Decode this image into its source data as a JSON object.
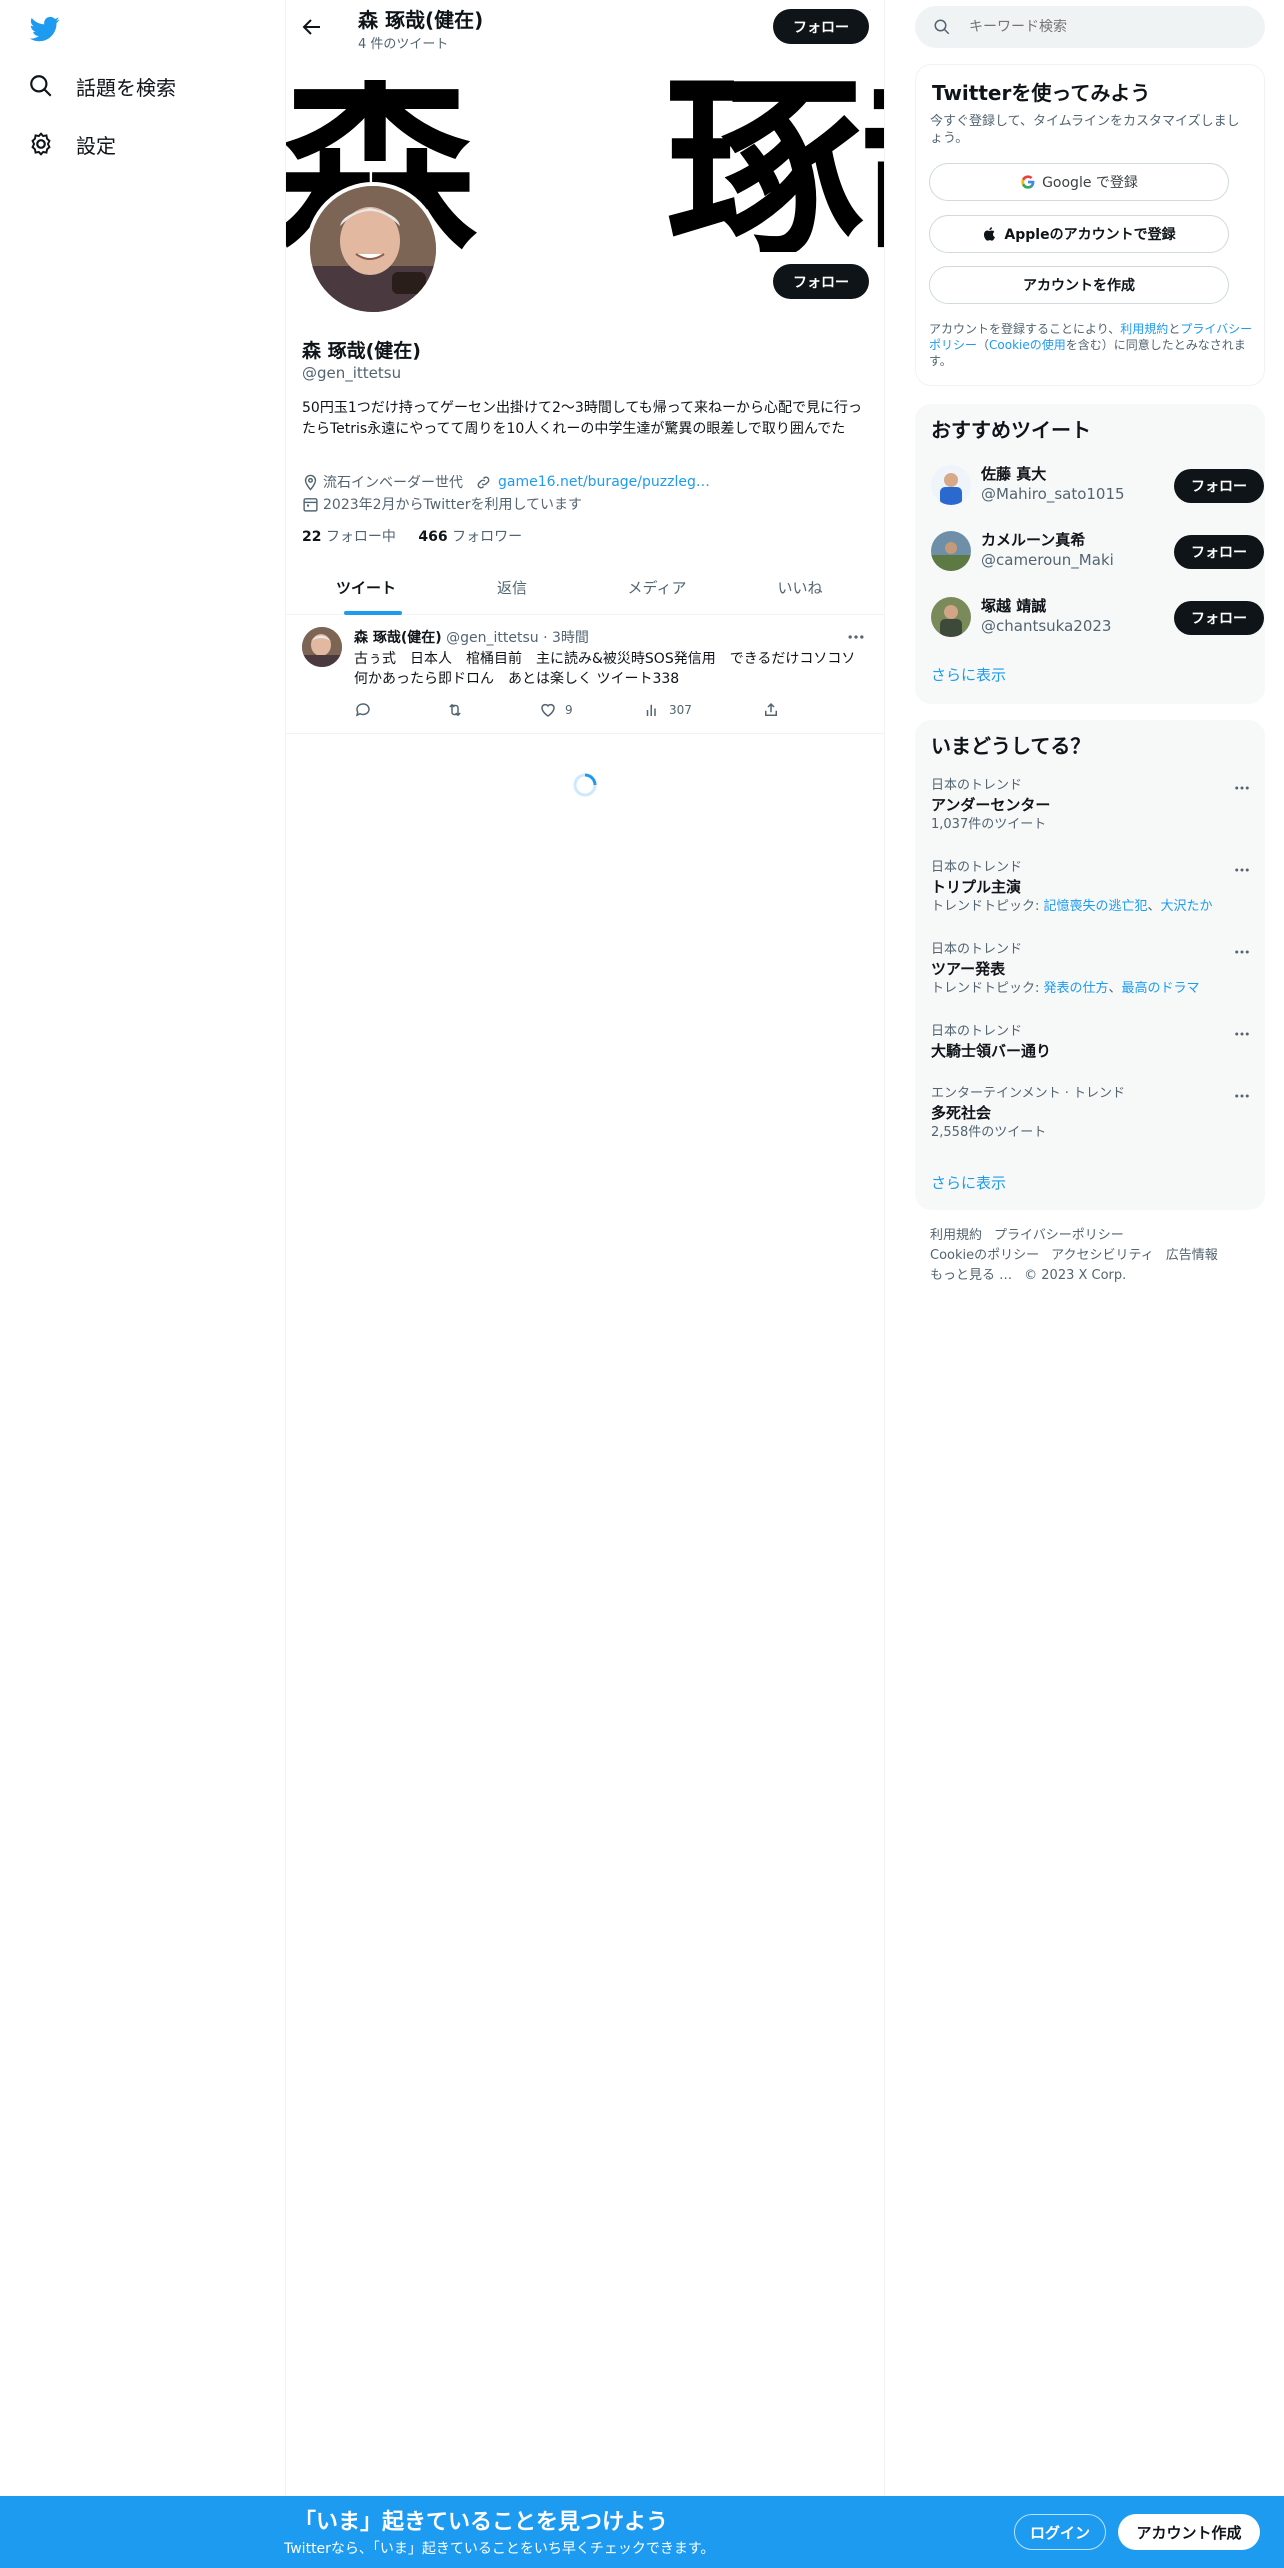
{
  "colors": {
    "accent": "#1d9bf0",
    "text": "#0f1419",
    "muted": "#536471"
  },
  "nav": {
    "logo": "twitter-bird-icon",
    "explore_label": "話題を検索",
    "settings_label": "設定"
  },
  "header": {
    "name": "森 琢哉(健在)",
    "tweet_count": "4 件のツイート",
    "follow_label": "フォロー"
  },
  "banner": {
    "text": "森　琢哉"
  },
  "profile": {
    "name": "森 琢哉(健在)",
    "handle": "@gen_ittetsu",
    "bio": "50円玉1つだけ持ってゲーセン出掛けて2〜3時間しても帰って来ねーから心配で見に行ったらTetris永遠にやってて周りを10人くれーの中学生達が驚異の眼差しで取り囲んでた",
    "location": "流石インベーダー世代",
    "url": "game16.net/burage/puzzleg…",
    "joined": "2023年2月からTwitterを利用しています",
    "following_count": "22",
    "following_label": "フォロー中",
    "followers_count": "466",
    "followers_label": "フォロワー",
    "follow_label": "フォロー"
  },
  "tabs": [
    "ツイート",
    "返信",
    "メディア",
    "いいね"
  ],
  "tweet": {
    "name": "森 琢哉(健在)",
    "handle": "@gen_ittetsu",
    "time": "· 3時間",
    "text": "古ぅ式　日本人　棺桶目前　主に読み&被災時SOS発信用　できるだけコソコソ　何かあったら即ドロん　あとは楽しく ツイート338",
    "likes": "9",
    "views": "307"
  },
  "search": {
    "placeholder": "キーワード検索"
  },
  "signup": {
    "title": "Twitterを使ってみよう",
    "subtitle": "今すぐ登録して、タイムラインをカスタマイズしましょう。",
    "google_label": "Google で登録",
    "apple_label": "Appleのアカウントで登録",
    "create_label": "アカウントを作成",
    "legal_1": "アカウントを登録することにより、",
    "legal_terms": "利用規約",
    "legal_2": "と",
    "legal_privacy": "プライバシーポリシー",
    "legal_3": "（",
    "legal_cookie": "Cookieの使用",
    "legal_4": "を含む）に同意したとみなされます。"
  },
  "who_to_follow": {
    "title": "おすすめツイート",
    "users": [
      {
        "name": "佐藤 真大",
        "handle": "@Mahiro_sato1015",
        "follow": "フォロー"
      },
      {
        "name": "カメルーン真希",
        "handle": "@cameroun_Maki",
        "follow": "フォロー"
      },
      {
        "name": "塚越 靖誠",
        "handle": "@chantsuka2023",
        "follow": "フォロー"
      }
    ],
    "show_more": "さらに表示"
  },
  "trends": {
    "title": "いまどうしてる？",
    "items": [
      {
        "context": "日本のトレンド",
        "name": "アンダーセンター",
        "sub": "1,037件のツイート"
      },
      {
        "context": "日本のトレンド",
        "name": "トリプル主演",
        "sub_prefix": "トレンドトピック: ",
        "link1": "記憶喪失の逃亡犯",
        "sep": "、",
        "link2": "大沢たか"
      },
      {
        "context": "日本のトレンド",
        "name": "ツアー発表",
        "sub_prefix": "トレンドトピック: ",
        "link1": "発表の仕方",
        "sep": "、",
        "link2": "最高のドラマ"
      },
      {
        "context": "日本のトレンド",
        "name": "大騎士領バー通り"
      },
      {
        "context": "エンターテインメント · トレンド",
        "name": "多死社会",
        "sub": "2,558件のツイート"
      }
    ],
    "show_more": "さらに表示"
  },
  "footer": {
    "terms": "利用規約",
    "privacy": "プライバシーポリシー",
    "cookie": "Cookieのポリシー",
    "accessibility": "アクセシビリティ",
    "ads": "広告情報",
    "more": "もっと見る …",
    "copyright": "© 2023 X Corp."
  },
  "bottom_bar": {
    "title": "「いま」起きていることを見つけよう",
    "subtitle": "Twitterなら、「いま」起きていることをいち早くチェックできます。",
    "login": "ログイン",
    "signup": "アカウント作成"
  }
}
